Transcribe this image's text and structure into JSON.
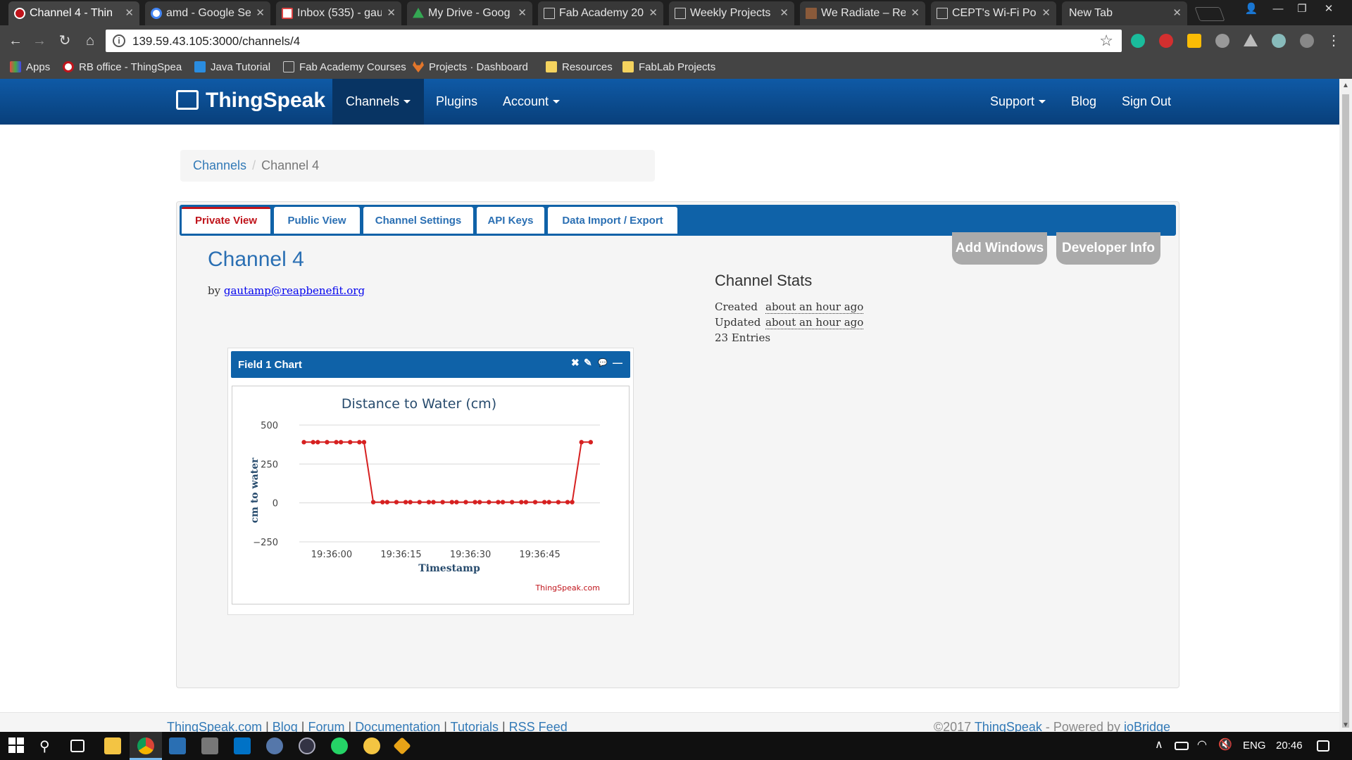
{
  "browser": {
    "tabs": [
      {
        "title": "Channel 4 - Thin",
        "active": true
      },
      {
        "title": "amd - Google Se"
      },
      {
        "title": "Inbox (535) - gau"
      },
      {
        "title": "My Drive - Goog"
      },
      {
        "title": "Fab Academy 20"
      },
      {
        "title": "Weekly Projects"
      },
      {
        "title": "We Radiate – Re"
      },
      {
        "title": "CEPT's Wi-Fi Por"
      },
      {
        "title": "New Tab"
      }
    ],
    "url": "139.59.43.105:3000/channels/4",
    "bookmarks": [
      {
        "label": "Apps"
      },
      {
        "label": "RB office - ThingSpea"
      },
      {
        "label": "Java Tutorial"
      },
      {
        "label": "Fab Academy Courses"
      },
      {
        "label": "Projects · Dashboard"
      },
      {
        "label": "Resources"
      },
      {
        "label": "FabLab Projects"
      }
    ]
  },
  "navbar": {
    "brand": "ThingSpeak",
    "channels": "Channels",
    "plugins": "Plugins",
    "account": "Account",
    "support": "Support",
    "blog": "Blog",
    "sign_out": "Sign Out"
  },
  "breadcrumb": {
    "parent": "Channels",
    "sep": "/",
    "current": "Channel 4"
  },
  "tabs": {
    "private_view": "Private View",
    "public_view": "Public View",
    "channel_settings": "Channel Settings",
    "api_keys": "API Keys",
    "data_import_export": "Data Import / Export"
  },
  "actions": {
    "add_windows": "Add Windows",
    "developer_info": "Developer Info"
  },
  "channel": {
    "title": "Channel 4",
    "by_label": "by",
    "owner_email": "gautamp@reapbenefit.org"
  },
  "stats": {
    "title": "Channel Stats",
    "created_label": "Created",
    "created_value": "about an hour ago",
    "updated_label": "Updated",
    "updated_value": "about an hour ago",
    "entries": "23 Entries"
  },
  "widget": {
    "title": "Field 1 Chart",
    "close": "✖",
    "edit": "✎",
    "comment": "💬",
    "minimize": "—"
  },
  "chart_data": {
    "type": "line",
    "title": "Distance to Water (cm)",
    "xlabel": "Timestamp",
    "ylabel": "cm to water",
    "credit": "ThingSpeak.com",
    "ylim": [
      -250,
      500
    ],
    "yticks": [
      500,
      250,
      0,
      -250
    ],
    "ytick_labels": [
      "500",
      "250",
      "0",
      "−250"
    ],
    "xlim": [
      "19:35:53",
      "19:36:58"
    ],
    "xticks": [
      "19:36:00",
      "19:36:15",
      "19:36:30",
      "19:36:45"
    ],
    "grid": "horizontal",
    "color": "#d62020",
    "series": [
      {
        "x": [
          "19:35:54",
          "19:35:56",
          "19:35:57",
          "19:35:59",
          "19:36:01",
          "19:36:02",
          "19:36:04",
          "19:36:06",
          "19:36:07",
          "19:36:09",
          "19:36:11",
          "19:36:12",
          "19:36:14",
          "19:36:16",
          "19:36:17",
          "19:36:19",
          "19:36:21",
          "19:36:22",
          "19:36:24",
          "19:36:26",
          "19:36:27",
          "19:36:29",
          "19:36:31",
          "19:36:32",
          "19:36:34",
          "19:36:36",
          "19:36:37",
          "19:36:39",
          "19:36:41",
          "19:36:42",
          "19:36:44",
          "19:36:46",
          "19:36:47",
          "19:36:49",
          "19:36:51",
          "19:36:52",
          "19:36:54",
          "19:36:56"
        ],
        "values": [
          390,
          390,
          390,
          390,
          390,
          390,
          390,
          390,
          390,
          5,
          5,
          5,
          5,
          5,
          5,
          5,
          5,
          5,
          5,
          5,
          5,
          5,
          5,
          5,
          5,
          5,
          5,
          5,
          5,
          5,
          5,
          5,
          5,
          5,
          5,
          5,
          390,
          390
        ]
      }
    ]
  },
  "footer": {
    "links": [
      "ThingSpeak.com",
      "Blog",
      "Forum",
      "Documentation",
      "Tutorials",
      "RSS Feed"
    ],
    "copyright_prefix": "©2017 ",
    "brand": "ThingSpeak",
    "powered_by": " - Powered by ",
    "iobridge": "ioBridge"
  },
  "taskbar": {
    "lang": "ENG",
    "time": "20:46"
  }
}
